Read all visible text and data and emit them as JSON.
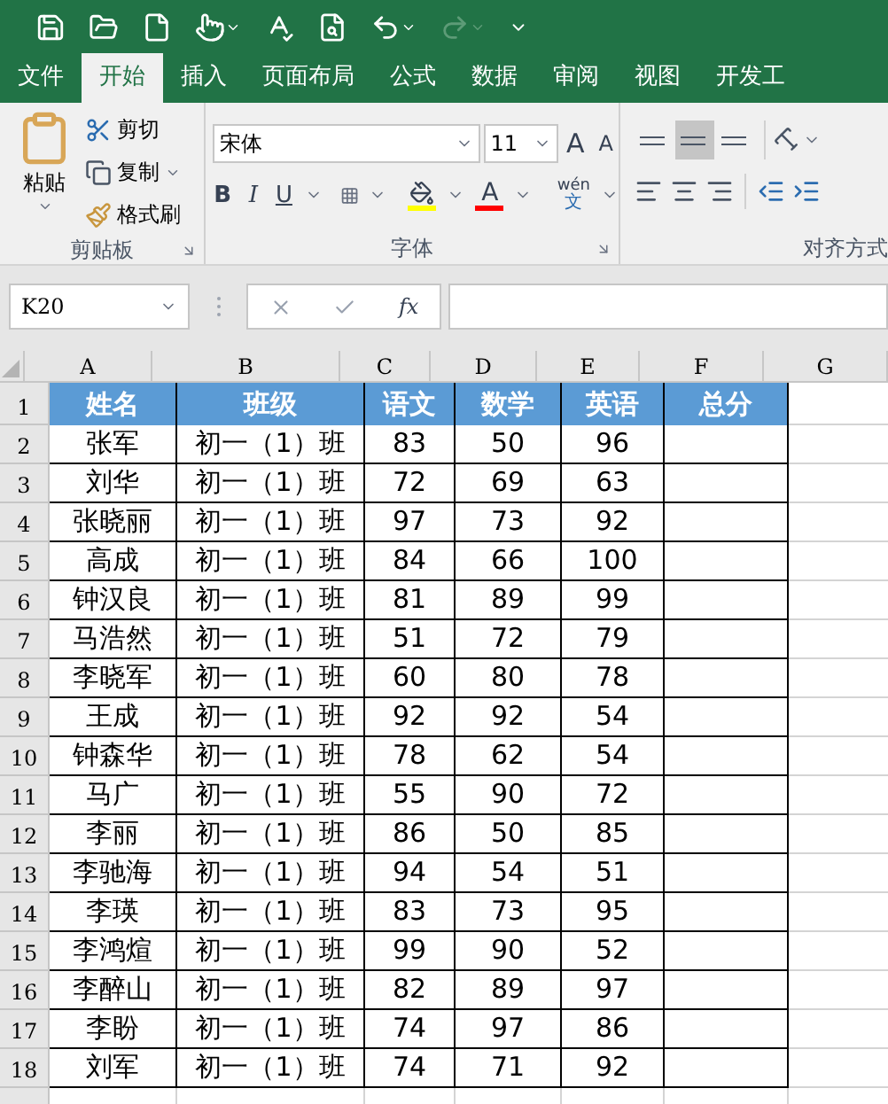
{
  "tabs": [
    {
      "label": "文件",
      "selected": false
    },
    {
      "label": "开始",
      "selected": true
    },
    {
      "label": "插入",
      "selected": false
    },
    {
      "label": "页面布局",
      "selected": false
    },
    {
      "label": "公式",
      "selected": false
    },
    {
      "label": "数据",
      "selected": false
    },
    {
      "label": "审阅",
      "selected": false
    },
    {
      "label": "视图",
      "selected": false
    },
    {
      "label": "开发工",
      "selected": false
    }
  ],
  "clipboard": {
    "paste": "粘贴",
    "cut": "剪切",
    "copy": "复制",
    "format_painter": "格式刷",
    "label": "剪贴板"
  },
  "font": {
    "font_name": "宋体",
    "font_size": "11",
    "grow": "A",
    "shrink": "A",
    "bold": "B",
    "italic": "I",
    "underline": "U",
    "font_color": "A",
    "phonetic_top": "wén",
    "phonetic_bottom": "文",
    "label": "字体"
  },
  "alignment": {
    "middle_align_selected": true,
    "label": "对齐方式"
  },
  "formula_bar": {
    "name_box": "K20",
    "fx": "fx"
  },
  "columns": [
    "A",
    "B",
    "C",
    "D",
    "E",
    "F",
    "G"
  ],
  "header_row": {
    "number": "1",
    "cells": [
      "姓名",
      "班级",
      "语文",
      "数学",
      "英语",
      "总分"
    ]
  },
  "rows": [
    {
      "number": "2",
      "cells": [
        "张军",
        "初一（1）班",
        "83",
        "50",
        "96"
      ]
    },
    {
      "number": "3",
      "cells": [
        "刘华",
        "初一（1）班",
        "72",
        "69",
        "63"
      ]
    },
    {
      "number": "4",
      "cells": [
        "张晓丽",
        "初一（1）班",
        "97",
        "73",
        "92"
      ]
    },
    {
      "number": "5",
      "cells": [
        "高成",
        "初一（1）班",
        "84",
        "66",
        "100"
      ]
    },
    {
      "number": "6",
      "cells": [
        "钟汉良",
        "初一（1）班",
        "81",
        "89",
        "99"
      ]
    },
    {
      "number": "7",
      "cells": [
        "马浩然",
        "初一（1）班",
        "51",
        "72",
        "79"
      ]
    },
    {
      "number": "8",
      "cells": [
        "李晓军",
        "初一（1）班",
        "60",
        "80",
        "78"
      ]
    },
    {
      "number": "9",
      "cells": [
        "王成",
        "初一（1）班",
        "92",
        "92",
        "54"
      ]
    },
    {
      "number": "10",
      "cells": [
        "钟森华",
        "初一（1）班",
        "78",
        "62",
        "54"
      ]
    },
    {
      "number": "11",
      "cells": [
        "马广",
        "初一（1）班",
        "55",
        "90",
        "72"
      ]
    },
    {
      "number": "12",
      "cells": [
        "李丽",
        "初一（1）班",
        "86",
        "50",
        "85"
      ]
    },
    {
      "number": "13",
      "cells": [
        "李驰海",
        "初一（1）班",
        "94",
        "54",
        "51"
      ]
    },
    {
      "number": "14",
      "cells": [
        "李瑛",
        "初一（1）班",
        "83",
        "73",
        "95"
      ]
    },
    {
      "number": "15",
      "cells": [
        "李鸿煊",
        "初一（1）班",
        "99",
        "90",
        "52"
      ]
    },
    {
      "number": "16",
      "cells": [
        "李醉山",
        "初一（1）班",
        "82",
        "89",
        "97"
      ]
    },
    {
      "number": "17",
      "cells": [
        "李盼",
        "初一（1）班",
        "74",
        "97",
        "86"
      ]
    },
    {
      "number": "18",
      "cells": [
        "刘军",
        "初一（1）班",
        "74",
        "71",
        "92"
      ]
    }
  ]
}
